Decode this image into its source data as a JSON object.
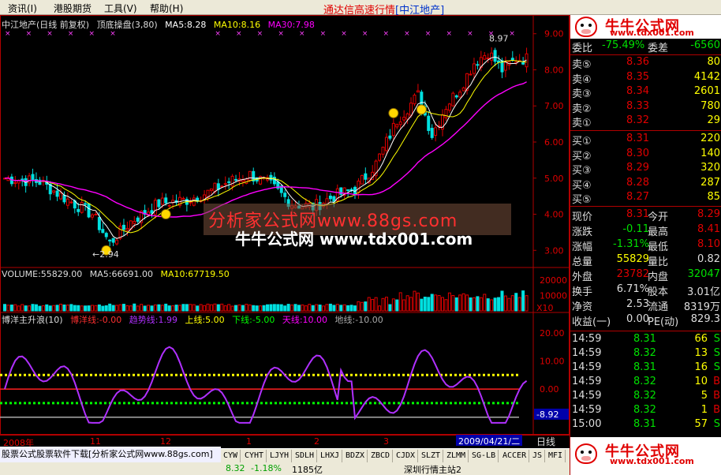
{
  "menu": {
    "items": [
      "资讯(I)",
      "港股期货",
      "工具(V)",
      "帮助(H)"
    ],
    "app_title": "通达信高速行情",
    "stock_tag": "[中江地产]"
  },
  "main_chart": {
    "header": {
      "stock": "中江地产(日线 前复权)",
      "indicator": "顶底操盘(3,80)",
      "ma5": "MA5:8.28",
      "ma10": "MA10:8.16",
      "ma30": "MA30:7.98"
    },
    "high_label": "8.97",
    "low_label": "2.94",
    "y_ticks": [
      "9.00",
      "8.00",
      "7.00",
      "6.00",
      "5.00",
      "4.00",
      "3.00"
    ]
  },
  "volume_chart": {
    "header": {
      "volume": "VOLUME:55829.00",
      "ma5": "MA5:66691.00",
      "ma10": "MA10:67719.50"
    },
    "y_ticks": [
      "20000",
      "10000"
    ],
    "scale_label": "X10"
  },
  "indicator_chart": {
    "header": {
      "name": "博洋主升浪(10)",
      "line1": "博洋线:-0.00",
      "line2": "趋势线:1.99",
      "line3": "上线:5.00",
      "line4": "下线:-5.00",
      "line5": "天线:10.00",
      "line6": "地线:-10.00"
    },
    "y_ticks": [
      "20.00",
      "10.00",
      "0.00"
    ],
    "current_value": "-8.92"
  },
  "watermarks": {
    "site1": "分析家公式网www.88gs.com",
    "site2": "牛牛公式网 www.tdx001.com"
  },
  "date_axis": {
    "labels": [
      "2008年",
      "11",
      "12",
      "1",
      "2",
      "3"
    ],
    "current_date": "2009/04/21/二",
    "period": "日线"
  },
  "quote": {
    "logo_name": "牛牛公式网",
    "logo_url": "www.tdx001.com",
    "weibi_label": "委比",
    "weibi_value": "-75.49%",
    "weicha_label": "委差",
    "weicha_value": "-6560",
    "sells": [
      {
        "label": "卖⑤",
        "price": "8.36",
        "vol": "80"
      },
      {
        "label": "卖④",
        "price": "8.35",
        "vol": "4142"
      },
      {
        "label": "卖③",
        "price": "8.34",
        "vol": "2601"
      },
      {
        "label": "卖②",
        "price": "8.33",
        "vol": "780"
      },
      {
        "label": "卖①",
        "price": "8.32",
        "vol": "29"
      }
    ],
    "buys": [
      {
        "label": "买①",
        "price": "8.31",
        "vol": "220"
      },
      {
        "label": "买②",
        "price": "8.30",
        "vol": "140"
      },
      {
        "label": "买③",
        "price": "8.29",
        "vol": "320"
      },
      {
        "label": "买④",
        "price": "8.28",
        "vol": "287"
      },
      {
        "label": "买⑤",
        "price": "8.27",
        "vol": "85"
      }
    ],
    "stats": [
      {
        "l1": "现价",
        "v1": "8.31",
        "l2": "今开",
        "v2": "8.29"
      },
      {
        "l1": "涨跌",
        "v1": "-0.11",
        "l2": "最高",
        "v2": "8.41"
      },
      {
        "l1": "涨幅",
        "v1": "-1.31%",
        "l2": "最低",
        "v2": "8.10"
      },
      {
        "l1": "总量",
        "v1": "55829",
        "l2": "量比",
        "v2": "0.82"
      },
      {
        "l1": "外盘",
        "v1": "23782",
        "l2": "内盘",
        "v2": "32047"
      },
      {
        "l1": "换手",
        "v1": "6.71%",
        "l2": "股本",
        "v2": "3.01亿"
      },
      {
        "l1": "净资",
        "v1": "2.53",
        "l2": "流通",
        "v2": "8319万"
      },
      {
        "l1": "收益(一)",
        "v1": "0.00",
        "l2": "PE(动)",
        "v2": "829.3"
      }
    ],
    "ticks": [
      {
        "time": "14:59",
        "price": "8.31",
        "vol": "66",
        "dir": "S"
      },
      {
        "time": "14:59",
        "price": "8.32",
        "vol": "13",
        "dir": "S"
      },
      {
        "time": "14:59",
        "price": "8.31",
        "vol": "16",
        "dir": "S"
      },
      {
        "time": "14:59",
        "price": "8.32",
        "vol": "10",
        "dir": "B"
      },
      {
        "time": "14:59",
        "price": "8.32",
        "vol": "5",
        "dir": "B"
      },
      {
        "time": "14:59",
        "price": "8.32",
        "vol": "1",
        "dir": "B"
      },
      {
        "time": "15:00",
        "price": "8.31",
        "vol": "57",
        "dir": "S"
      }
    ]
  },
  "tabs": [
    "CYW",
    "CYHT",
    "LJYH",
    "SDLH",
    "LHXJ",
    "BDZX",
    "ZBCD",
    "CJDX",
    "SLZT",
    "ZLMM",
    "SG-LB",
    "ACCER",
    "JS",
    "MFI"
  ],
  "ticker": "股票公式股票软件下载[分析家公式网www.88gs.com]",
  "status": {
    "a": "8.32",
    "b": "-1.18%",
    "c": "1185亿",
    "d": "深圳行情主站2"
  },
  "colors": {
    "up": "#e00000",
    "down": "#00e0e0",
    "ma5": "#ffffff",
    "ma10": "#ffff00",
    "ma30": "#ff00ff",
    "indicator_line": "#b030ff",
    "upper_dots": "#ffff00",
    "lower_dots": "#00ff00"
  }
}
